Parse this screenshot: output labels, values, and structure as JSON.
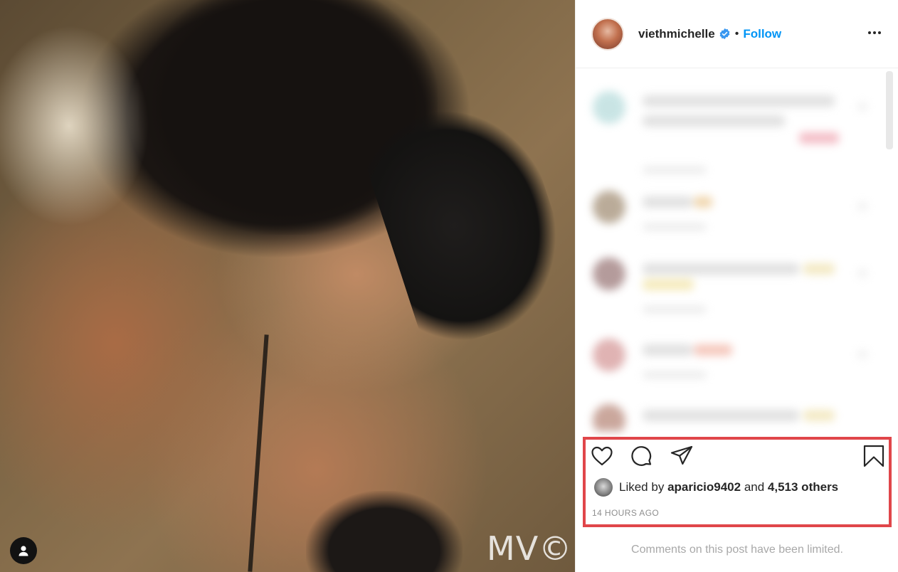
{
  "post": {
    "watermark": "MV©",
    "tag_icon": "user-tag-icon"
  },
  "header": {
    "username": "viethmichelle",
    "verified_icon": "verified-badge-icon",
    "separator": "•",
    "follow_label": "Follow",
    "more_icon": "more-options-icon"
  },
  "actions": {
    "like_icon": "heart-icon",
    "comment_icon": "comment-icon",
    "share_icon": "paper-plane-icon",
    "save_icon": "bookmark-icon"
  },
  "likes": {
    "prefix": "Liked by",
    "user": "aparicio9402",
    "and": "and",
    "others": "4,513 others"
  },
  "timestamp": "14 HOURS AGO",
  "comments_notice": "Comments on this post have been limited.",
  "colors": {
    "follow": "#0095f6",
    "highlight_border": "#e0464a",
    "verified": "#3897f0"
  }
}
